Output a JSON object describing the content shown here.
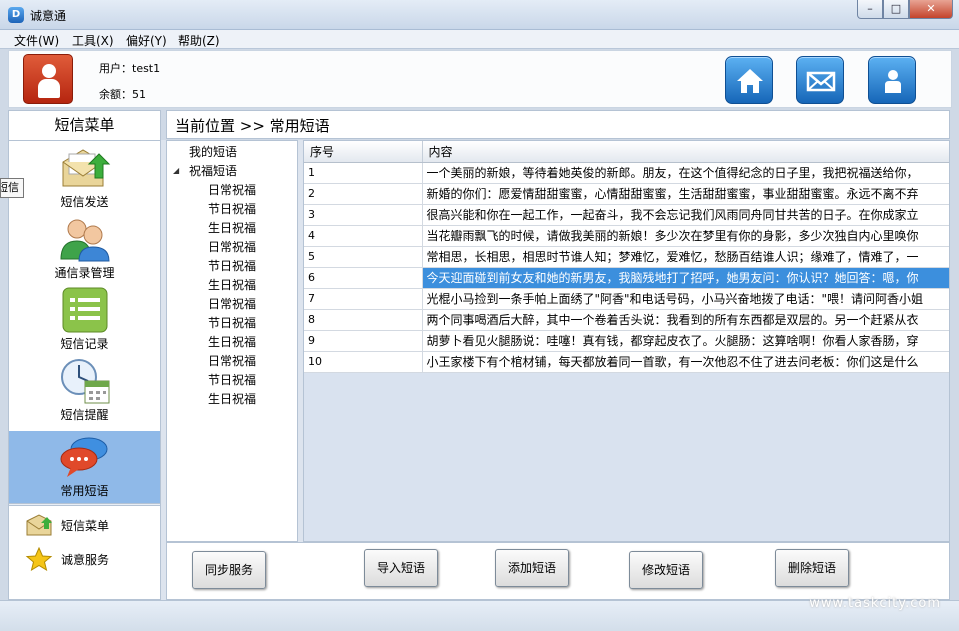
{
  "window": {
    "title": "诚意通",
    "icon_text": "D",
    "controls": [
      "–",
      "□",
      "✕"
    ]
  },
  "menu": [
    {
      "label": "文件(W)"
    },
    {
      "label": "工具(X)"
    },
    {
      "label": "偏好(Y)"
    },
    {
      "label": "帮助(Z)"
    }
  ],
  "header": {
    "user": "用户：test1",
    "balance": "余额：51",
    "buttons": [
      "home-icon",
      "mail-icon",
      "user-icon"
    ]
  },
  "left": {
    "title": "短信菜单",
    "nav": [
      {
        "label": "短信发送",
        "icon": "envelope-send-icon"
      },
      {
        "label": "通信录管理",
        "icon": "contacts-icon"
      },
      {
        "label": "短信记录",
        "icon": "list-icon"
      },
      {
        "label": "短信提醒",
        "icon": "clock-calendar-icon"
      },
      {
        "label": "常用短语",
        "icon": "chat-bubbles-icon",
        "active": true
      }
    ],
    "bottom": [
      {
        "label": "短信菜单",
        "icon": "envelope-icon"
      },
      {
        "label": "诚意服务",
        "icon": "star-icon"
      }
    ],
    "tooltip": "短信"
  },
  "location": {
    "text": "当前位置 >> 常用短语"
  },
  "tree": {
    "root1": "我的短语",
    "root2": "祝福短语",
    "children": [
      "日常祝福",
      "节日祝福",
      "生日祝福",
      "日常祝福",
      "节日祝福",
      "生日祝福",
      "日常祝福",
      "节日祝福",
      "生日祝福",
      "日常祝福",
      "节日祝福",
      "生日祝福"
    ]
  },
  "grid": {
    "columns": [
      "序号",
      "内容"
    ],
    "selected_index": 5,
    "rows": [
      {
        "num": "1",
        "content": "一个美丽的新娘，等待着她英俊的新郎。朋友，在这个值得纪念的日子里，我把祝福送给你，"
      },
      {
        "num": "2",
        "content": "新婚的你们：愿爱情甜甜蜜蜜，心情甜甜蜜蜜，生活甜甜蜜蜜，事业甜甜蜜蜜。永远不离不弃"
      },
      {
        "num": "3",
        "content": "很高兴能和你在一起工作，一起奋斗，我不会忘记我们风雨同舟同甘共苦的日子。在你成家立"
      },
      {
        "num": "4",
        "content": "当花瓣雨飘飞的时候，请做我美丽的新娘！多少次在梦里有你的身影，多少次独自内心里唤你"
      },
      {
        "num": "5",
        "content": "常相思，长相思，相思时节谁人知；梦难忆，爱难忆，愁肠百结谁人识；缘难了，情难了，一"
      },
      {
        "num": "6",
        "content": "今天迎面碰到前女友和她的新男友，我脑残地打了招呼，她男友问：你认识？她回答：嗯，你"
      },
      {
        "num": "7",
        "content": "光棍小马捡到一条手帕上面绣了\"阿香\"和电话号码，小马兴奋地拨了电话：\"喂！请问阿香小姐"
      },
      {
        "num": "8",
        "content": " 两个同事喝酒后大醉，其中一个卷着舌头说：我看到的所有东西都是双层的。另一个赶紧从衣"
      },
      {
        "num": "9",
        "content": "胡萝卜看见火腿肠说：哇噻！真有钱，都穿起皮衣了。火腿肠：这算啥啊！你看人家香肠，穿"
      },
      {
        "num": "10",
        "content": "小王家楼下有个棺材铺，每天都放着同一首歌，有一次他忍不住了进去问老板：你们这是什么"
      }
    ]
  },
  "buttons": {
    "sync": "同步服务",
    "import": "导入短语",
    "add": "添加短语",
    "edit": "修改短语",
    "delete": "删除短语"
  },
  "watermark": "www.taskcity.com"
}
